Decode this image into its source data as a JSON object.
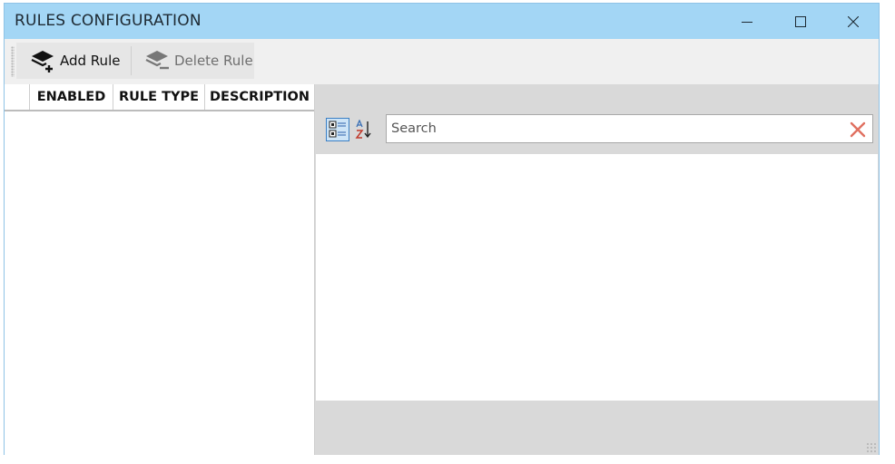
{
  "window": {
    "title": "RULES CONFIGURATION"
  },
  "toolbar": {
    "add_label": "Add Rule",
    "delete_label": "Delete Rule"
  },
  "grid": {
    "columns": [
      "",
      "ENABLED",
      "RULE TYPE",
      "DESCRIPTION"
    ],
    "rows": []
  },
  "properties": {
    "search_placeholder": "Search",
    "sort_mode": "categorized"
  },
  "colors": {
    "titlebar": "#a3d6f5",
    "clear_icon": "#e07060"
  },
  "icons": [
    "minimize-icon",
    "maximize-icon",
    "close-icon",
    "add-rule-icon",
    "delete-rule-icon",
    "categorized-icon",
    "alphabetical-sort-icon",
    "clear-search-icon"
  ]
}
